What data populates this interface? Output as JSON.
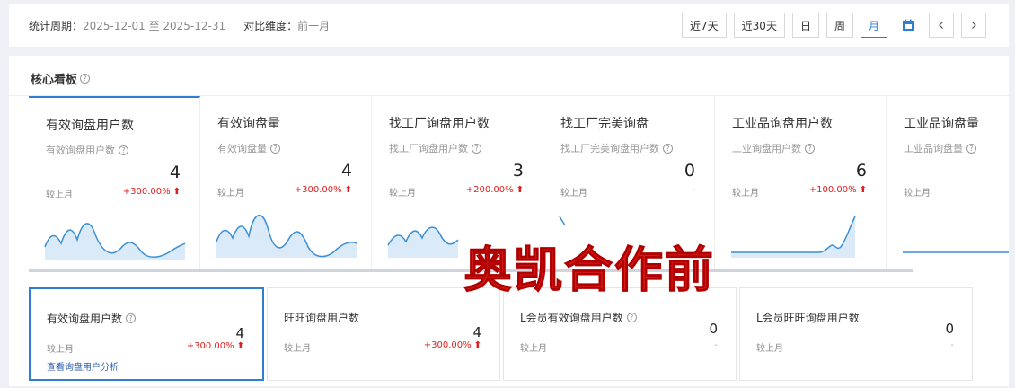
{
  "filter": {
    "period_label": "统计周期：",
    "period_value": "2025-12-01 至 2025-12-31",
    "compare_label": "对比维度：",
    "compare_value": "前一月"
  },
  "range_buttons": [
    {
      "label": "近7天",
      "active": false
    },
    {
      "label": "近30天",
      "active": false
    },
    {
      "label": "日",
      "active": false
    },
    {
      "label": "周",
      "active": false
    },
    {
      "label": "月",
      "active": true
    }
  ],
  "icons": {
    "calendar": "calendar-icon",
    "prev": "chevron-left-icon",
    "next": "chevron-right-icon",
    "help": "question-circle-icon",
    "up": "arrow-up-icon"
  },
  "colors": {
    "accent": "#2f7fd0",
    "increase": "#e02020",
    "spark_line": "#3a8fd6",
    "spark_fill": "#dbeaf8"
  },
  "panel": {
    "title": "核心看板"
  },
  "cards": [
    {
      "title": "有效询盘用户数",
      "subtitle": "有效询盘用户数",
      "value": "4",
      "compare_label": "较上月",
      "change": "+300.00%",
      "trend": "up",
      "active": true
    },
    {
      "title": "有效询盘量",
      "subtitle": "有效询盘量",
      "value": "4",
      "compare_label": "较上月",
      "change": "+300.00%",
      "trend": "up",
      "active": false
    },
    {
      "title": "找工厂询盘用户数",
      "subtitle": "找工厂询盘用户数",
      "value": "3",
      "compare_label": "较上月",
      "change": "+200.00%",
      "trend": "up",
      "active": false
    },
    {
      "title": "找工厂完美询盘",
      "subtitle": "找工厂完美询盘用户数",
      "value": "0",
      "compare_label": "较上月",
      "change": "-",
      "trend": "none",
      "active": false
    },
    {
      "title": "工业品询盘用户数",
      "subtitle": "工业询盘用户数",
      "value": "6",
      "compare_label": "较上月",
      "change": "+100.00%",
      "trend": "up",
      "active": false
    },
    {
      "title": "工业品询盘量",
      "subtitle": "工业品询盘量",
      "value": "",
      "compare_label": "较上月",
      "change": "",
      "trend": "none",
      "active": false
    }
  ],
  "sub_cards": [
    {
      "title": "有效询盘用户数",
      "value": "4",
      "compare_label": "较上月",
      "change": "+300.00%",
      "trend": "up",
      "link": "查看询盘用户分析",
      "help": true,
      "active": true
    },
    {
      "title": "旺旺询盘用户数",
      "value": "4",
      "compare_label": "较上月",
      "change": "+300.00%",
      "trend": "up",
      "link": "",
      "help": false,
      "active": false
    },
    {
      "title": "L会员有效询盘用户数",
      "value": "0",
      "compare_label": "较上月",
      "change": "-",
      "trend": "none",
      "link": "",
      "help": true,
      "active": false
    },
    {
      "title": "L会员旺旺询盘用户数",
      "value": "0",
      "compare_label": "较上月",
      "change": "-",
      "trend": "none",
      "link": "",
      "help": false,
      "active": false
    }
  ],
  "watermark": "奥凯合作前"
}
